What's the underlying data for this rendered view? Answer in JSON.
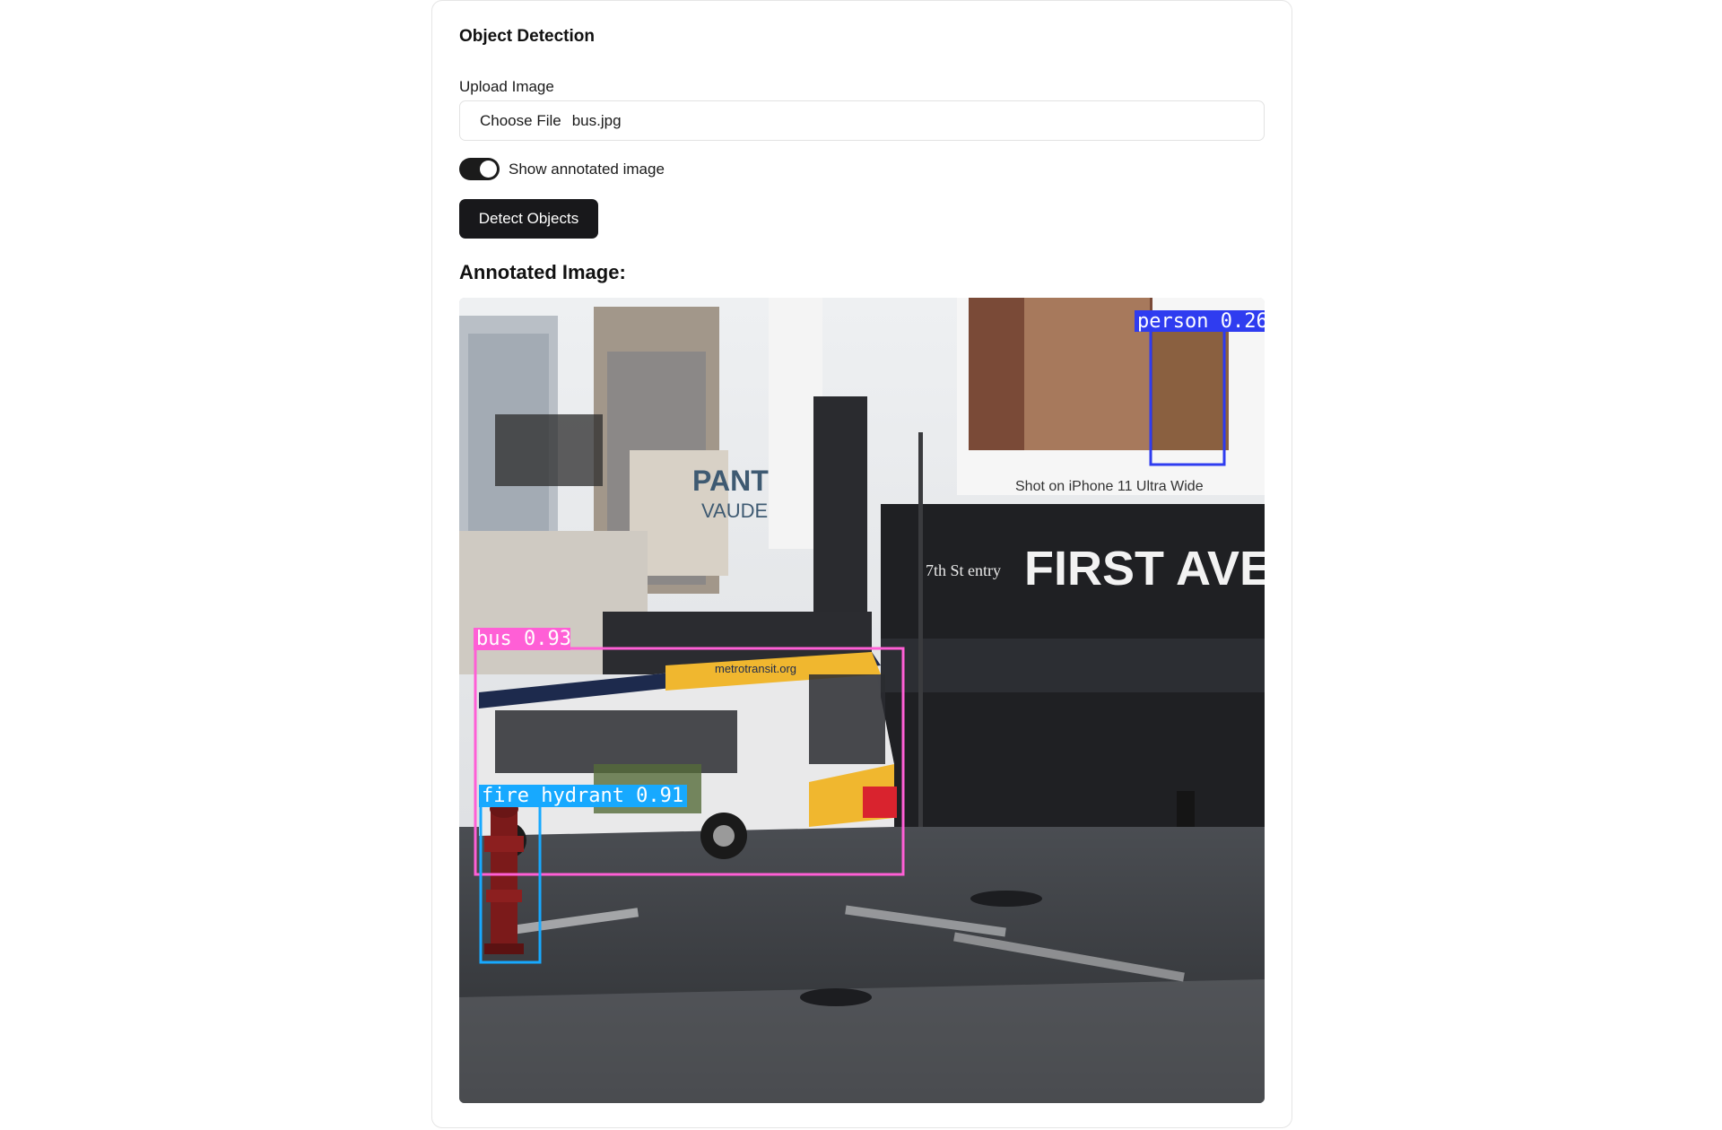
{
  "form": {
    "title": "Object Detection",
    "upload_label": "Upload Image",
    "choose_file_label": "Choose File",
    "file_name": "bus.jpg",
    "toggle_label": "Show annotated image",
    "toggle_on": true,
    "detect_button": "Detect Objects"
  },
  "result": {
    "heading": "Annotated Image:",
    "scene_text": {
      "billboard_caption": "Shot on iPhone 11 Ultra Wide",
      "venue_sign": "FIRST AVENUE",
      "building_sign_1": "PANT",
      "building_sign_2": "VAUDE",
      "star_sign": "7th St entry",
      "bus_livery": "metrotransit.org"
    },
    "detections": [
      {
        "label": "person 0.26",
        "color": "#2f3cf0"
      },
      {
        "label": "bus 0.93",
        "color": "#ff5fd6"
      },
      {
        "label": "fire hydrant 0.91",
        "color": "#17a9ff"
      }
    ]
  },
  "colors": {
    "button_bg": "#18181b",
    "toggle_bg": "#1b1b1b",
    "card_border": "#e5e5e5"
  }
}
